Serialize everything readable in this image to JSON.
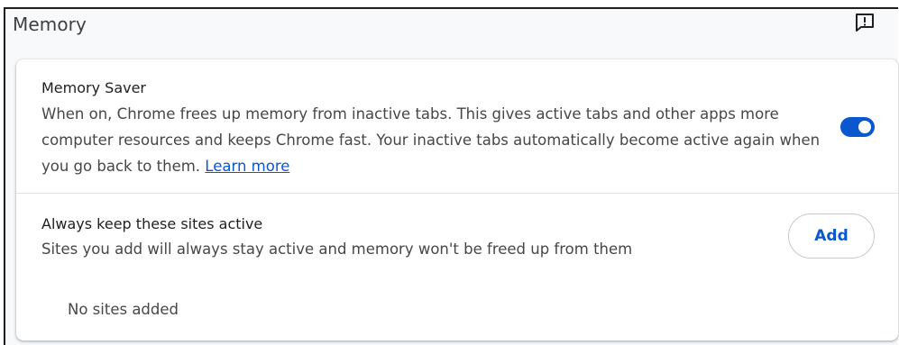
{
  "page": {
    "title": "Memory"
  },
  "header": {
    "feedback_icon": "feedback-icon"
  },
  "memory_saver": {
    "title": "Memory Saver",
    "description": "When on, Chrome frees up memory from inactive tabs. This gives active tabs and other apps more computer resources and keeps Chrome fast. Your inactive tabs automatically become active again when you go back to them.",
    "learn_more": "Learn more",
    "enabled": true,
    "accent_color": "#0b57d0"
  },
  "active_sites": {
    "title": "Always keep these sites active",
    "description": "Sites you add will always stay active and memory won't be freed up from them",
    "add_label": "Add",
    "empty_text": "No sites added"
  }
}
